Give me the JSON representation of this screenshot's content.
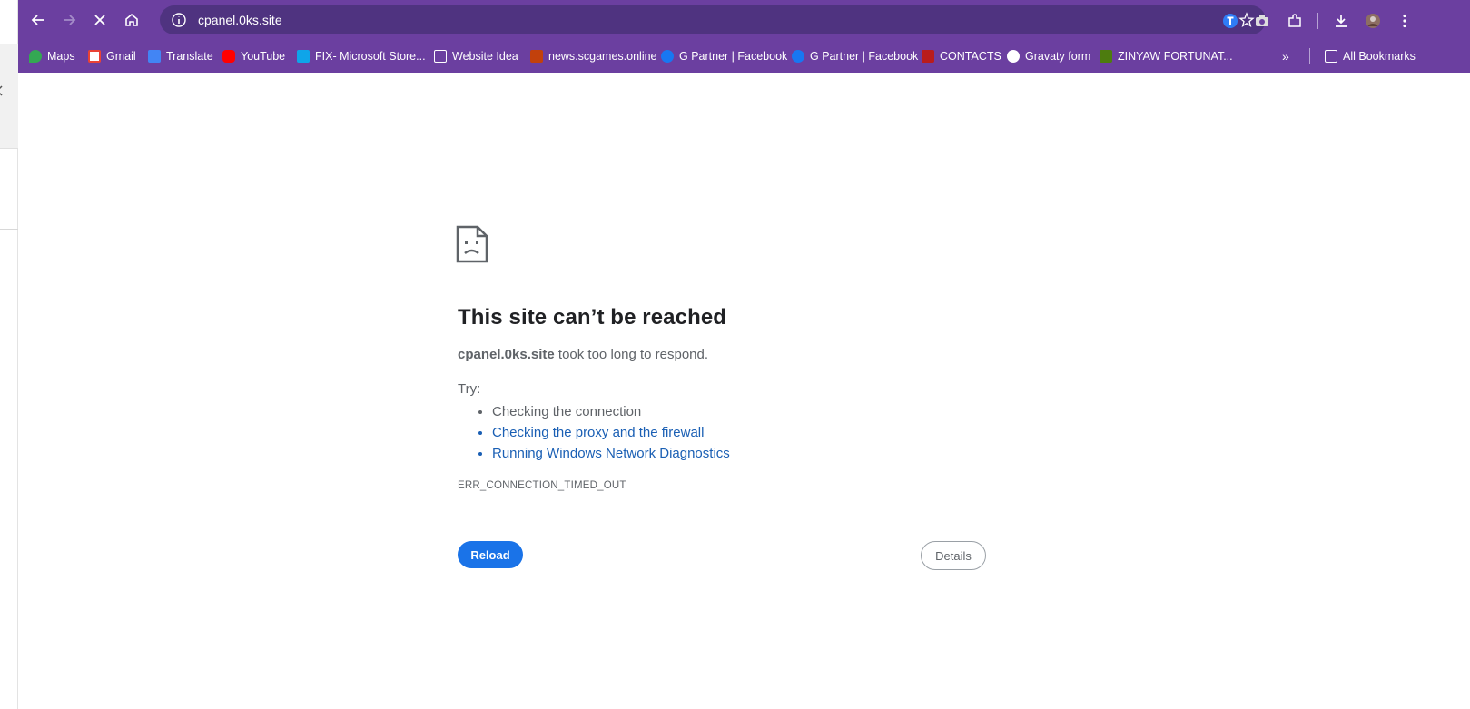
{
  "browser": {
    "url": "cpanel.0ks.site",
    "bookmarks": [
      {
        "label": "Maps",
        "color": "#34a853"
      },
      {
        "label": "Gmail",
        "color": "#ea4335"
      },
      {
        "label": "Translate",
        "color": "#4285f4"
      },
      {
        "label": "YouTube",
        "color": "#ff0000"
      },
      {
        "label": "FIX- Microsoft Store...",
        "color": "#0ea5e9"
      },
      {
        "label": "Website Idea",
        "color": "folder"
      },
      {
        "label": "news.scgames.online",
        "color": "#c2410c"
      },
      {
        "label": "G Partner | Facebook",
        "color": "#1877f2"
      },
      {
        "label": "G Partner | Facebook",
        "color": "#1877f2"
      },
      {
        "label": "CONTACTS",
        "color": "#b91c1c"
      },
      {
        "label": "Gravaty form",
        "color": "#ffffff"
      },
      {
        "label": "ZINYAW FORTUNAT...",
        "color": "#4d7c0f"
      }
    ],
    "all_bookmarks": "All Bookmarks"
  },
  "error": {
    "title": "This site can’t be reached",
    "host": "cpanel.0ks.site",
    "message_suffix": " took too long to respond.",
    "try_label": "Try:",
    "suggestions": [
      {
        "text": "Checking the connection",
        "link": false
      },
      {
        "text": "Checking the proxy and the firewall",
        "link": true
      },
      {
        "text": "Running Windows Network Diagnostics",
        "link": true
      }
    ],
    "code": "ERR_CONNECTION_TIMED_OUT",
    "reload_label": "Reload",
    "details_label": "Details"
  },
  "colors": {
    "frame": "#6b3fa0",
    "omnibox": "#4f3380",
    "primary_button": "#1a73e8",
    "link": "#1a5fb4"
  }
}
